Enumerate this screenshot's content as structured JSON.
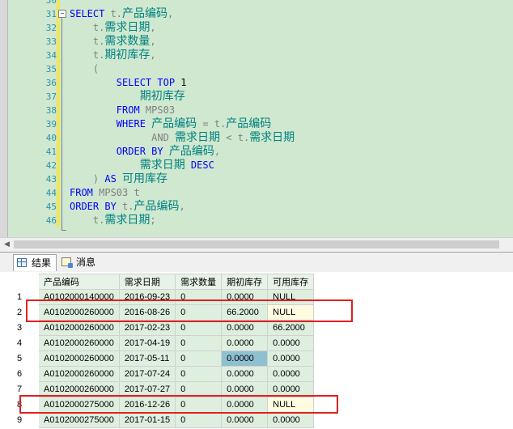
{
  "editor": {
    "lines": [
      {
        "num": "30",
        "code": []
      },
      {
        "num": "31",
        "code": [
          [
            "kw",
            "SELECT "
          ],
          [
            "gr",
            "t."
          ],
          [
            "id",
            "产品编码"
          ],
          [
            "gr",
            ","
          ]
        ]
      },
      {
        "num": "32",
        "code": [
          [
            "nm",
            "    "
          ],
          [
            "gr",
            "t."
          ],
          [
            "id",
            "需求日期"
          ],
          [
            "gr",
            ","
          ]
        ]
      },
      {
        "num": "33",
        "code": [
          [
            "nm",
            "    "
          ],
          [
            "gr",
            "t."
          ],
          [
            "id",
            "需求数量"
          ],
          [
            "gr",
            ","
          ]
        ]
      },
      {
        "num": "34",
        "code": [
          [
            "nm",
            "    "
          ],
          [
            "gr",
            "t."
          ],
          [
            "id",
            "期初库存"
          ],
          [
            "gr",
            ","
          ]
        ]
      },
      {
        "num": "35",
        "code": [
          [
            "nm",
            "    "
          ],
          [
            "gr",
            "("
          ]
        ]
      },
      {
        "num": "36",
        "code": [
          [
            "nm",
            "        "
          ],
          [
            "kw",
            "SELECT TOP "
          ],
          [
            "nm",
            "1"
          ]
        ]
      },
      {
        "num": "37",
        "code": [
          [
            "nm",
            "            "
          ],
          [
            "id",
            "期初库存"
          ]
        ]
      },
      {
        "num": "38",
        "code": [
          [
            "nm",
            "        "
          ],
          [
            "kw",
            "FROM "
          ],
          [
            "gr",
            "MPS03"
          ]
        ]
      },
      {
        "num": "39",
        "code": [
          [
            "nm",
            "        "
          ],
          [
            "kw",
            "WHERE "
          ],
          [
            "id",
            "产品编码"
          ],
          [
            "gr",
            " = t."
          ],
          [
            "id",
            "产品编码"
          ]
        ]
      },
      {
        "num": "40",
        "code": [
          [
            "nm",
            "              "
          ],
          [
            "gr",
            "AND "
          ],
          [
            "id",
            "需求日期"
          ],
          [
            "gr",
            " < t."
          ],
          [
            "id",
            "需求日期"
          ]
        ]
      },
      {
        "num": "41",
        "code": [
          [
            "nm",
            "        "
          ],
          [
            "kw",
            "ORDER BY "
          ],
          [
            "id",
            "产品编码"
          ],
          [
            "gr",
            ","
          ]
        ]
      },
      {
        "num": "42",
        "code": [
          [
            "nm",
            "            "
          ],
          [
            "id",
            "需求日期"
          ],
          [
            "kw",
            " DESC"
          ]
        ]
      },
      {
        "num": "43",
        "code": [
          [
            "nm",
            "    "
          ],
          [
            "gr",
            ") "
          ],
          [
            "kw",
            "AS "
          ],
          [
            "id",
            "可用库存"
          ]
        ]
      },
      {
        "num": "44",
        "code": [
          [
            "kw",
            "FROM "
          ],
          [
            "gr",
            "MPS03 t"
          ]
        ]
      },
      {
        "num": "45",
        "code": [
          [
            "kw",
            "ORDER BY "
          ],
          [
            "gr",
            "t."
          ],
          [
            "id",
            "产品编码"
          ],
          [
            "gr",
            ","
          ]
        ]
      },
      {
        "num": "46",
        "code": [
          [
            "nm",
            "    "
          ],
          [
            "gr",
            "t."
          ],
          [
            "id",
            "需求日期"
          ],
          [
            "gr",
            ";"
          ]
        ]
      }
    ]
  },
  "tabs": {
    "results_label": "结果",
    "messages_label": "消息"
  },
  "results": {
    "columns": [
      "产品编码",
      "需求日期",
      "需求数量",
      "期初库存",
      "可用库存"
    ],
    "rows": [
      {
        "n": "1",
        "cells": [
          "A0102000140000",
          "2016-09-23",
          "0",
          "0.0000",
          "NULL"
        ]
      },
      {
        "n": "2",
        "cells": [
          "A0102000260000",
          "2016-08-26",
          "0",
          "66.2000",
          "NULL"
        ]
      },
      {
        "n": "3",
        "cells": [
          "A0102000260000",
          "2017-02-23",
          "0",
          "0.0000",
          "66.2000"
        ]
      },
      {
        "n": "4",
        "cells": [
          "A0102000260000",
          "2017-04-19",
          "0",
          "0.0000",
          "0.0000"
        ]
      },
      {
        "n": "5",
        "cells": [
          "A0102000260000",
          "2017-05-11",
          "0",
          "0.0000",
          "0.0000"
        ]
      },
      {
        "n": "6",
        "cells": [
          "A0102000260000",
          "2017-07-24",
          "0",
          "0.0000",
          "0.0000"
        ]
      },
      {
        "n": "7",
        "cells": [
          "A0102000260000",
          "2017-07-27",
          "0",
          "0.0000",
          "0.0000"
        ]
      },
      {
        "n": "8",
        "cells": [
          "A0102000275000",
          "2016-12-26",
          "0",
          "0.0000",
          "NULL"
        ]
      },
      {
        "n": "9",
        "cells": [
          "A0102000275000",
          "2017-01-15",
          "0",
          "0.0000",
          "0.0000"
        ]
      }
    ],
    "selected_cell": {
      "row": 5,
      "col": 3
    },
    "highlighted_rows": [
      2,
      8
    ],
    "annotation_color": "#e02020"
  }
}
